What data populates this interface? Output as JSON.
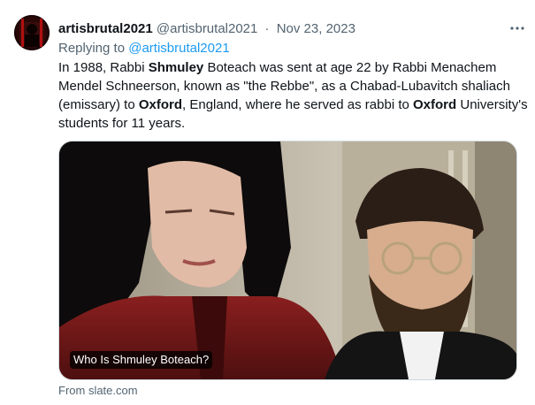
{
  "tweet": {
    "display_name": "artisbrutal2021",
    "handle": "@artisbrutal2021",
    "separator": "·",
    "date": "Nov 23, 2023",
    "more_icon": "more-dots-icon",
    "replying_prefix": "Replying to",
    "replying_handle": "@artisbrutal2021",
    "text_segments": [
      "In 1988, Rabbi ",
      "Shmuley",
      " Boteach was sent at age 22 by Rabbi Menachem Mendel Schneerson, known as \"the Rebbe\", as a Chabad-Lubavitch shaliach (emissary) to ",
      "Oxford",
      ", England, where he served as rabbi to ",
      "Oxford",
      " University's students for 11 years."
    ],
    "card": {
      "title": "Who Is Shmuley Boteach?",
      "source": "From slate.com"
    }
  }
}
